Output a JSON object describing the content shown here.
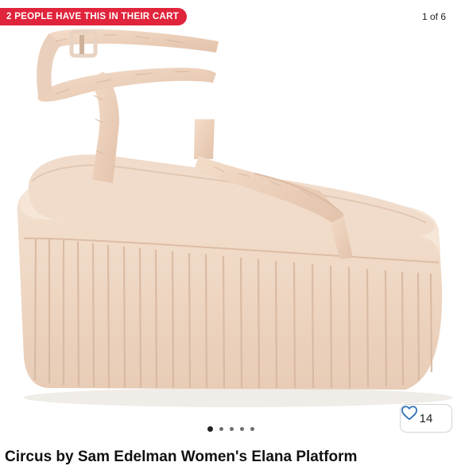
{
  "badge": {
    "text": "2 PEOPLE HAVE THIS IN THEIR CART",
    "color": "#e0243b"
  },
  "gallery": {
    "counter": "1 of 6",
    "current": 1,
    "total": 6
  },
  "likes": {
    "count": "14",
    "icon": "heart-outline-icon",
    "accent": "#2f72b8"
  },
  "listing": {
    "title": "Circus by Sam Edelman Women's Elana Platform"
  },
  "product": {
    "color": "#f2dcc9"
  }
}
